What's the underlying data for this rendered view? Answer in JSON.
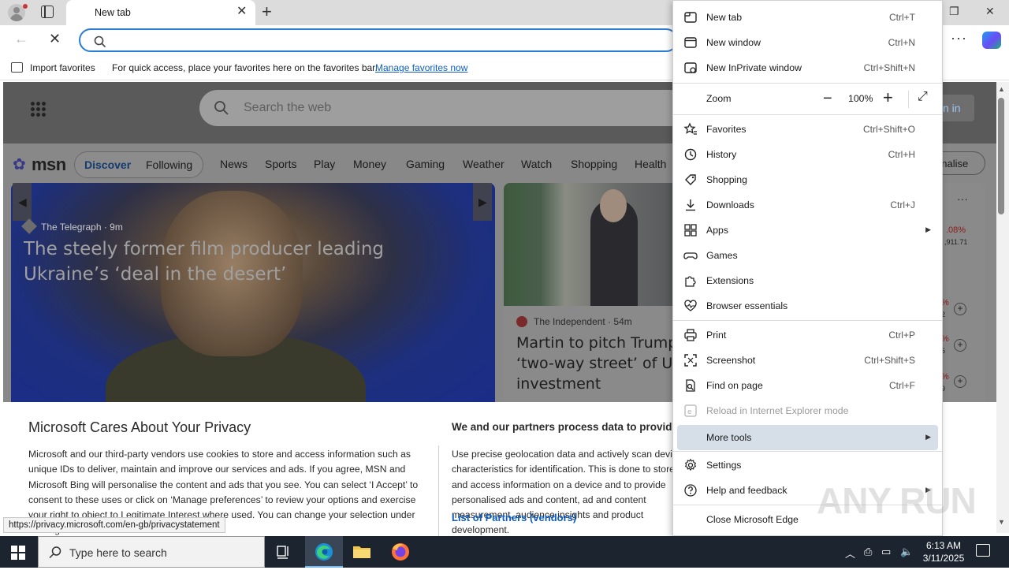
{
  "browser": {
    "tab_title": "New tab",
    "address_placeholder": "",
    "favbar": {
      "import_label": "Import favorites",
      "hint": "For quick access, place your favorites here on the favorites bar.",
      "manage_link": "Manage favorites now"
    }
  },
  "msn": {
    "search_placeholder": "Search the web",
    "signin_label": "n in",
    "logo_text": "msn",
    "tabs": [
      "Discover",
      "Following"
    ],
    "nav": [
      "News",
      "Sports",
      "Play",
      "Money",
      "Gaming",
      "Weather",
      "Watch",
      "Shopping",
      "Health"
    ],
    "personalise_label": "onalise",
    "hero": {
      "source": "The Telegraph",
      "age": "9m",
      "title": "The steely former film producer leading Ukraine’s ‘deal in the desert’"
    },
    "card2": {
      "source": "The Independent",
      "age": "54m",
      "title": "Martin to pitch Trump ‘two-way street’ of US investment"
    },
    "side": {
      "pct": ".08%",
      "num": ",911.71",
      "row_pcts": [
        "%",
        "%",
        "%"
      ],
      "row_nums": [
        "2",
        "6",
        "9"
      ]
    }
  },
  "privacy": {
    "title": "Microsoft Cares About Your Privacy",
    "body": "Microsoft and our third-party vendors use cookies to store and access information such as unique IDs to deliver, maintain and improve our services and ads. If you agree, MSN and Microsoft Bing will personalise the content and ads that you see. You can select ‘I Accept’ to consent to these uses or click on ‘Manage preferences’ to review your options and exercise your right to object to Legitimate Interest where used. You can change your selection under ‘Manage Preferences’ at the bottom of",
    "right_title": "We and our partners process data to provide:",
    "right_body": "Use precise geolocation data and actively scan device characteristics for identification. This is done to store and access information on a device and to provide personalised ads and content, ad and content measurement, audience insights and product development.",
    "partners_link": "List of Partners (vendors)",
    "status_url": "https://privacy.microsoft.com/en-gb/privacystatement"
  },
  "menu": {
    "items": [
      {
        "label": "New tab",
        "shortcut": "Ctrl+T",
        "icon": "new-tab-icon"
      },
      {
        "label": "New window",
        "shortcut": "Ctrl+N",
        "icon": "new-window-icon"
      },
      {
        "label": "New InPrivate window",
        "shortcut": "Ctrl+Shift+N",
        "icon": "inprivate-icon"
      },
      {
        "label": "Zoom",
        "shortcut": "",
        "icon": ""
      },
      {
        "label": "Favorites",
        "shortcut": "Ctrl+Shift+O",
        "icon": "star-icon"
      },
      {
        "label": "History",
        "shortcut": "Ctrl+H",
        "icon": "history-icon"
      },
      {
        "label": "Shopping",
        "shortcut": "",
        "icon": "tag-icon"
      },
      {
        "label": "Downloads",
        "shortcut": "Ctrl+J",
        "icon": "download-icon"
      },
      {
        "label": "Apps",
        "shortcut": "",
        "icon": "apps-icon"
      },
      {
        "label": "Games",
        "shortcut": "",
        "icon": "games-icon"
      },
      {
        "label": "Extensions",
        "shortcut": "",
        "icon": "puzzle-icon"
      },
      {
        "label": "Browser essentials",
        "shortcut": "",
        "icon": "heart-pulse-icon"
      },
      {
        "label": "Print",
        "shortcut": "Ctrl+P",
        "icon": "printer-icon"
      },
      {
        "label": "Screenshot",
        "shortcut": "Ctrl+Shift+S",
        "icon": "screenshot-icon"
      },
      {
        "label": "Find on page",
        "shortcut": "Ctrl+F",
        "icon": "find-icon"
      },
      {
        "label": "Reload in Internet Explorer mode",
        "shortcut": "",
        "icon": "ie-icon"
      },
      {
        "label": "More tools",
        "shortcut": "",
        "icon": ""
      },
      {
        "label": "Settings",
        "shortcut": "",
        "icon": "gear-icon"
      },
      {
        "label": "Help and feedback",
        "shortcut": "",
        "icon": "help-icon"
      },
      {
        "label": "Close Microsoft Edge",
        "shortcut": "",
        "icon": ""
      }
    ],
    "zoom_value": "100%"
  },
  "taskbar": {
    "search_placeholder": "Type here to search",
    "time": "6:13 AM",
    "date": "3/11/2025"
  },
  "watermark": "ANY RUN",
  "colors": {
    "accent": "#2b7cd3",
    "menu_highlight": "#d6dfe8",
    "taskbar": "#1c2430"
  }
}
